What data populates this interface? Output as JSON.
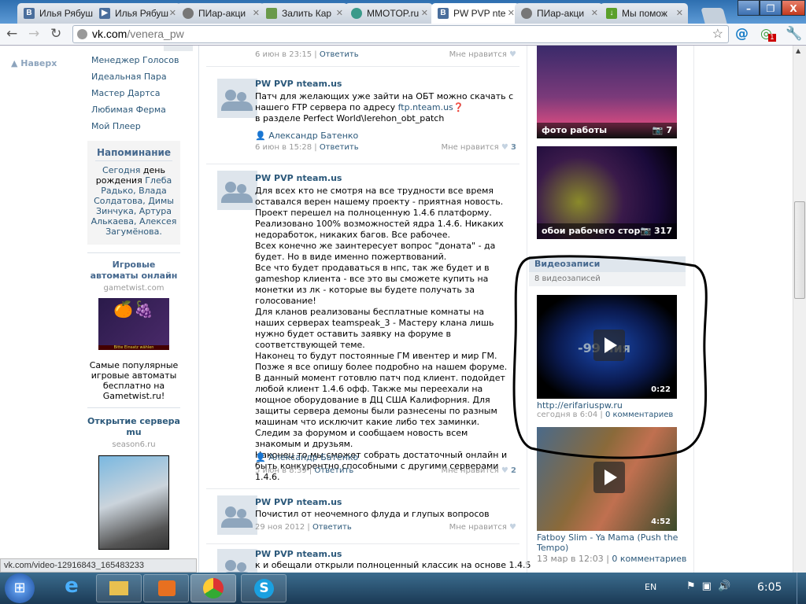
{
  "browser": {
    "tabs": [
      {
        "label": "Илья Рябуш",
        "icon": "vk-icon"
      },
      {
        "label": "Илья Рябуш",
        "icon": "video-icon"
      },
      {
        "label": "ПИар-акци",
        "icon": "globe-icon"
      },
      {
        "label": "Залить Кар",
        "icon": "image-icon"
      },
      {
        "label": "MMOTOP.ru",
        "icon": "mmotop-icon"
      },
      {
        "label": "PW PVP nte",
        "icon": "vk-icon",
        "active": true
      },
      {
        "label": "ПИар-акци",
        "icon": "globe-icon"
      },
      {
        "label": "Мы помож",
        "icon": "download-icon"
      }
    ],
    "url_host": "vk.com",
    "url_path": "/venera_pw",
    "window_buttons": {
      "minimize": "–",
      "maximize": "❐",
      "close": "X"
    },
    "status_url": "vk.com/video-12916843_165483233",
    "extension_badge": "1"
  },
  "nav": {
    "up_label": "Наверх"
  },
  "left_menu": [
    "Менеджер Голосов",
    "Идеальная Пара",
    "Мастер Дартса",
    "Любимая Ферма",
    "Мой Плеер"
  ],
  "reminder": {
    "title": "Напоминание",
    "text_prefix": "Сегодня",
    "text_bold": "день рождения",
    "names": "Глеба Радько, Влада Солдатова, Димы Зинчука, Артура Алькаева, Алексея Загумёнова."
  },
  "ads": [
    {
      "title": "Игровые автоматы онлайн",
      "domain": "gametwist.com",
      "text": "Самые популярные игровые автоматы бесплатно на Gametwist.ru!",
      "banner_text": "Bitte Einsatz wählen"
    },
    {
      "title": "Открытие сервера mu",
      "domain": "season6.ru"
    }
  ],
  "posts": [
    {
      "date": "6 июн в 23:15",
      "reply": "Ответить",
      "like": "Мне нравится",
      "count": ""
    },
    {
      "author": "PW PVP nteam.us",
      "text": "Патч для желающих уже зайти на ОБТ можно скачать с нашего FTP сервера по адресу",
      "link": "ftp.nteam.us",
      "text2": "в разделе Perfect World\\Ierehon_obt_patch",
      "signer": "Александр Батенко",
      "date": "6 июн в 15:28",
      "reply": "Ответить",
      "like": "Мне нравится",
      "count": "3"
    },
    {
      "author": "PW PVP nteam.us",
      "text": "Для всех кто не смотря на все трудности все время оставался верен нашему проекту - приятная новость. Проект перешел на полноценную 1.4.6 платформу. Реализовано 100% возможностей ядра 1.4.6. Никаких недоработок, никаких багов. Все рабочее.\nВсех конечно же заинтересует вопрос \"доната\" - да будет. Но в виде именно пожертвований.\nВсе что будет продаваться в нпс, так же будет и в gameshop клиента - все это вы сможете купить на монетки из лк - которые вы будете получать за голосование!\nДля кланов реализованы бесплатные комнаты на наших серверах teamspeak_3 - Мастеру клана лишь нужно будет оставить заявку на форуме в соответствующей теме.\nНаконец то будут постоянные ГМ ивентер и мир ГМ.\nПозже я все опишу более подробно на нашем форуме.\nВ данный момент готовлю патч под клиент. подойдет любой клиент 1.4.6 офф. Также мы переехали на мощное оборудование в ДЦ США Калифорния. Для защиты сервера демоны были разнесены по разным машинам что исключит какие либо тех заминки.\nСледим за форумом и сообщаем новость всем знакомым и друзьям.\nНаконец то мы сможет собрать достаточный онлайн и быть конкурентно способными с другими серверами 1.4.6.",
      "signer": "Александр Батенко",
      "date": "5 июн в 8:39",
      "reply": "Ответить",
      "like": "Мне нравится",
      "count": "2"
    },
    {
      "author": "PW PVP nteam.us",
      "text": "Почистил от неочемного флуда и глупых вопросов",
      "date": "29 ноя 2012",
      "reply": "Ответить",
      "like": "Мне нравится",
      "count": ""
    },
    {
      "author": "PW PVP nteam.us",
      "text": "к и обещали открыли полноценный классик на основе 1.4.5"
    }
  ],
  "albums": [
    {
      "title": "фото работы",
      "count": "7"
    },
    {
      "title": "обои рабочего стора",
      "count": "317"
    }
  ],
  "videos": {
    "title": "Видеозаписи",
    "count_label": "8 видеозаписей",
    "items": [
      {
        "title": "http://erifariuspw.ru",
        "duration": "0:22",
        "date": "сегодня в 6:04",
        "comments": "0 комментариев",
        "overlay_text": "-99 ния"
      },
      {
        "title": "Fatboy Slim - Ya Mama (Push the Tempo)",
        "duration": "4:52",
        "date": "13 мар в 12:03",
        "comments": "0 комментариев"
      }
    ]
  },
  "taskbar": {
    "lang": "EN",
    "time": "6:05"
  }
}
